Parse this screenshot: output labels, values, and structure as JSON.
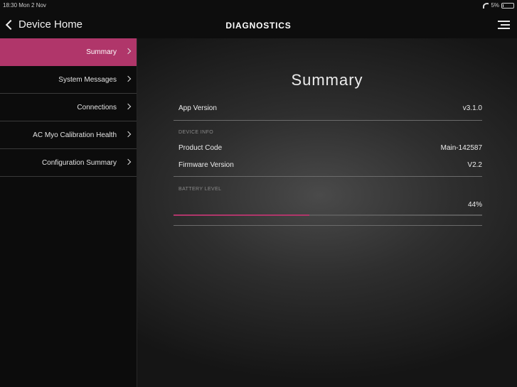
{
  "status_bar": {
    "time": "18:30  Mon 2 Nov",
    "battery_text": "5%",
    "battery_level": 0.05
  },
  "nav": {
    "back_label": "Device Home",
    "title": "DIAGNOSTICS"
  },
  "sidebar": {
    "items": [
      {
        "label": "Summary",
        "active": true
      },
      {
        "label": "System Messages",
        "active": false
      },
      {
        "label": "Connections",
        "active": false
      },
      {
        "label": "AC Myo Calibration Health",
        "active": false
      },
      {
        "label": "Configuration Summary",
        "active": false
      }
    ]
  },
  "summary": {
    "title": "Summary",
    "app_version_label": "App Version",
    "app_version_value": "v3.1.0",
    "device_info_header": "DEVICE INFO",
    "product_code_label": "Product Code",
    "product_code_value": "Main-142587",
    "firmware_label": "Firmware Version",
    "firmware_value": "V2.2",
    "battery_header": "BATTERY LEVEL",
    "battery_value": "44%",
    "battery_fraction": 0.44
  },
  "colors": {
    "accent": "#b0366a",
    "background": "#0d0d0d",
    "text": "#e8e8e8"
  }
}
